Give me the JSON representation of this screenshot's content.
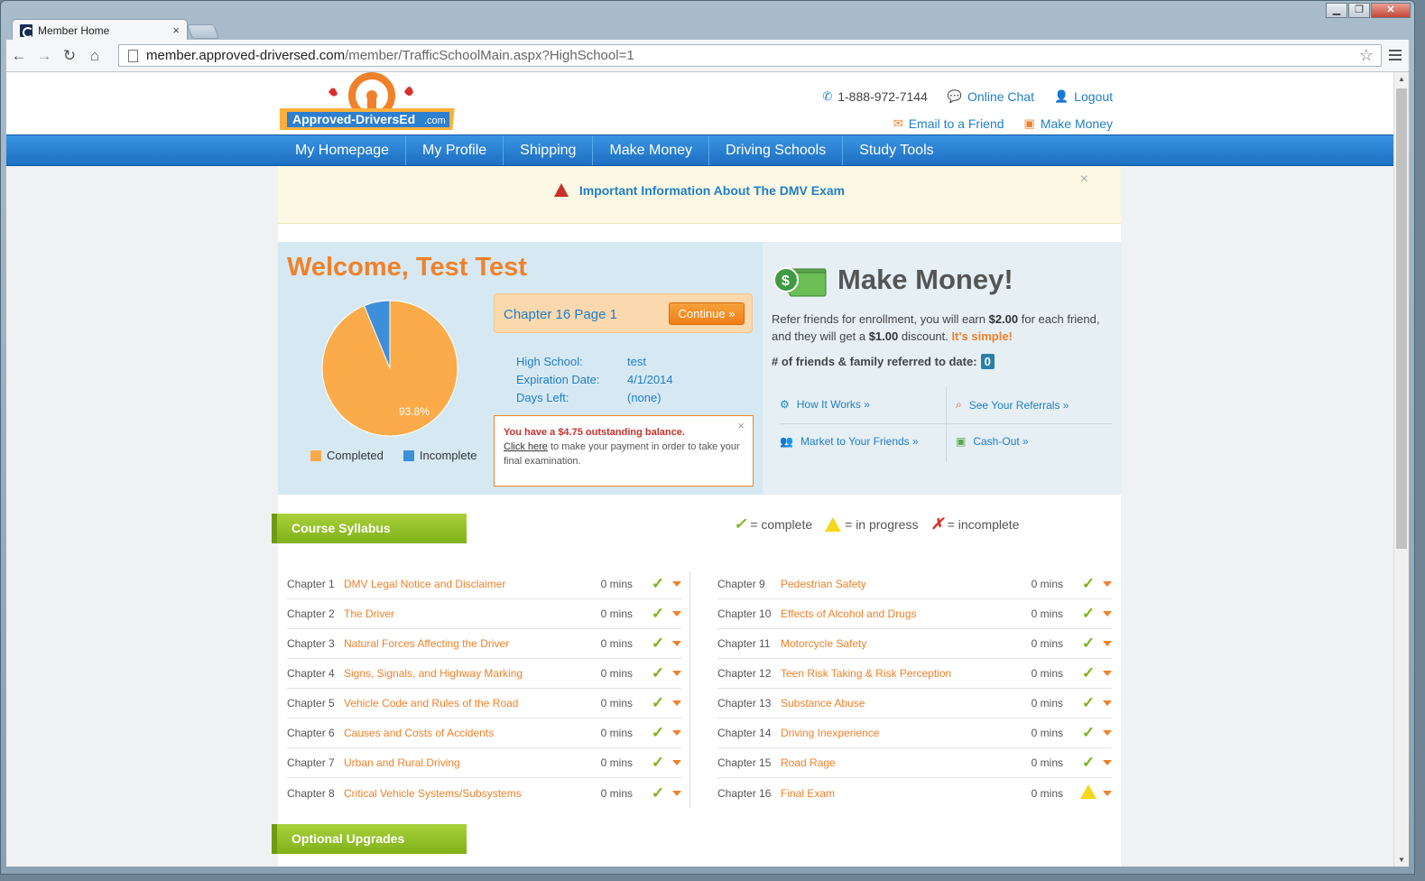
{
  "browser": {
    "tab_title": "Member Home",
    "tab_close": "×",
    "url_host": "member.approved-driversed.com",
    "url_path": "/member/TrafficSchoolMain.aspx?HighSchool=1",
    "back": "←",
    "forward": "→",
    "reload": "↻",
    "home": "⌂",
    "star": "☆",
    "min": "▁",
    "max": "❐",
    "close": "✕"
  },
  "header": {
    "logo_text": "Approved-DriversEd",
    "logo_com": ".com",
    "phone": "1-888-972-7144",
    "chat": "Online Chat",
    "logout": "Logout",
    "email": "Email to a Friend",
    "make_money": "Make Money"
  },
  "nav": [
    "My Homepage",
    "My Profile",
    "Shipping",
    "Make Money",
    "Driving Schools",
    "Study Tools"
  ],
  "alert": {
    "text": "Important Information About The DMV Exam",
    "close": "×"
  },
  "welcome": {
    "greeting": "Welcome, Test Test",
    "pie_label": "93.8%",
    "completed_pct": 93.8,
    "legend_completed": "Completed",
    "legend_incomplete": "Incomplete",
    "current": "Chapter 16 Page 1",
    "continue": "Continue »",
    "high_school_label": "High School:",
    "high_school_value": "test",
    "expiration_label": "Expiration Date:",
    "expiration_value": "4/1/2014",
    "days_label": "Days Left:",
    "days_value": "(none)",
    "balance_title": "You have a $4.75 outstanding balance.",
    "balance_link": "Click here",
    "balance_text": " to make your payment in order to take your final examination.",
    "balance_close": "×"
  },
  "money": {
    "title": "Make Money!",
    "p1": "Refer friends for enrollment, you will earn ",
    "earn": "$2.00",
    "p2": " for each friend, and they will get a ",
    "discount": "$1.00",
    "p3": " discount. ",
    "simple": "It's simple!",
    "count_label": "# of friends & family referred to date:",
    "count": "0",
    "how": "How It Works »",
    "referrals": "See Your Referrals »",
    "market": "Market to Your Friends »",
    "cashout": "Cash-Out »"
  },
  "syllabus": {
    "title": "Course Syllabus",
    "key_complete": "= complete",
    "key_progress": "= in progress",
    "key_incomplete": "= incomplete",
    "left": [
      {
        "num": "Chapter 1",
        "title": "DMV Legal Notice and Disclaimer",
        "mins": "0 mins",
        "status": "complete"
      },
      {
        "num": "Chapter 2",
        "title": "The Driver",
        "mins": "0 mins",
        "status": "complete"
      },
      {
        "num": "Chapter 3",
        "title": "Natural Forces Affecting the Driver",
        "mins": "0 mins",
        "status": "complete"
      },
      {
        "num": "Chapter 4",
        "title": "Signs, Signals, and Highway Marking",
        "mins": "0 mins",
        "status": "complete"
      },
      {
        "num": "Chapter 5",
        "title": "Vehicle Code and Rules of the Road",
        "mins": "0 mins",
        "status": "complete"
      },
      {
        "num": "Chapter 6",
        "title": "Causes and Costs of Accidents",
        "mins": "0 mins",
        "status": "complete"
      },
      {
        "num": "Chapter 7",
        "title": "Urban and Rural Driving",
        "mins": "0 mins",
        "status": "complete"
      },
      {
        "num": "Chapter 8",
        "title": "Critical Vehicle Systems/Subsystems",
        "mins": "0 mins",
        "status": "complete"
      }
    ],
    "right": [
      {
        "num": "Chapter 9",
        "title": "Pedestrian Safety",
        "mins": "0 mins",
        "status": "complete"
      },
      {
        "num": "Chapter 10",
        "title": "Effects of Alcohol and Drugs",
        "mins": "0 mins",
        "status": "complete"
      },
      {
        "num": "Chapter 11",
        "title": "Motorcycle Safety",
        "mins": "0 mins",
        "status": "complete"
      },
      {
        "num": "Chapter 12",
        "title": "Teen Risk Taking & Risk Perception",
        "mins": "0 mins",
        "status": "complete"
      },
      {
        "num": "Chapter 13",
        "title": "Substance Abuse",
        "mins": "0 mins",
        "status": "complete"
      },
      {
        "num": "Chapter 14",
        "title": "Driving Inexperience",
        "mins": "0 mins",
        "status": "complete"
      },
      {
        "num": "Chapter 15",
        "title": "Road Rage",
        "mins": "0 mins",
        "status": "complete"
      },
      {
        "num": "Chapter 16",
        "title": "Final Exam",
        "mins": "0 mins",
        "status": "in-progress"
      }
    ]
  },
  "upgrades": {
    "title": "Optional Upgrades"
  },
  "colors": {
    "orange": "#f0812a",
    "blue": "#1f7fc6",
    "green": "#7fb21a",
    "pie_completed": "#fbab4a",
    "pie_incomplete": "#3d8fd9"
  }
}
